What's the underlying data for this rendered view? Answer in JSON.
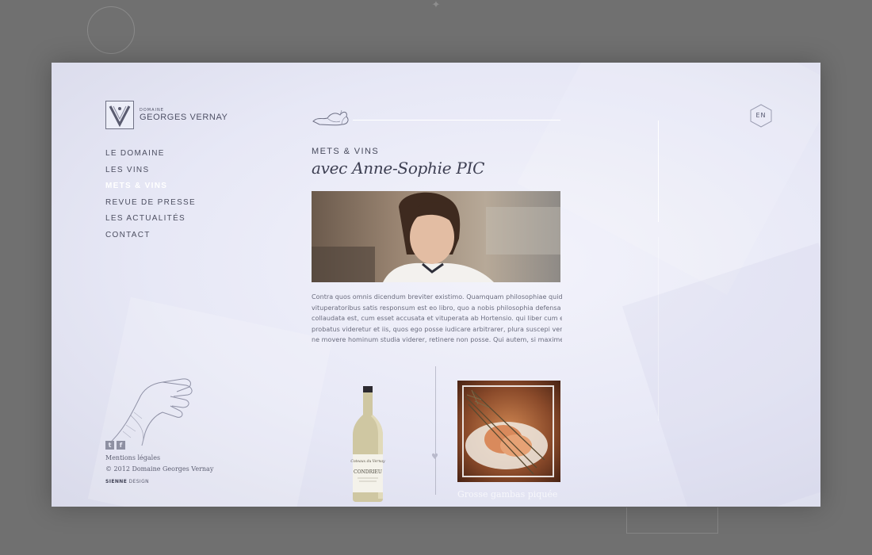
{
  "brand": {
    "domaine": "DOMAINE",
    "name": "GEORGES VERNAY"
  },
  "nav": {
    "items": [
      {
        "label": "LE DOMAINE"
      },
      {
        "label": "LES VINS"
      },
      {
        "label": "METS & VINS",
        "active": true
      },
      {
        "label": "REVUE DE PRESSE"
      },
      {
        "label": "LES ACTUALITÉS"
      },
      {
        "label": "CONTACT"
      }
    ]
  },
  "language": "EN",
  "article": {
    "tag": "METS & VINS",
    "title": "avec Anne-Sophie PIC",
    "body_lines": [
      "Contra quos omnis dicendum breviter existimo. Quamquam philosophiae quidem",
      "vituperatoribus satis responsum est eo libro, quo a nobis philosophia defensa et",
      "collaudata est, cum esset accusata et vituperata ab Hortensio. qui liber cum et tibi",
      "probatus videretur et iis, quos ego posse iudicare arbitrarer, plura suscepi veritus",
      "ne movere hominum studia viderer, retinere non posse. Qui autem, si maxime hoc"
    ]
  },
  "bottle_label": {
    "top": "Coteaux du Vernay",
    "main": "CONDRIEU"
  },
  "dish_caption": "Grosse gambas piquée",
  "footer": {
    "social": [
      "t",
      "f"
    ],
    "legal": "Mentions légales",
    "copyright": "© 2012 Domaine Georges Vernay",
    "credit_brand": "SIENNE",
    "credit_suffix": " DESIGN"
  },
  "colors": {
    "background": "#707070",
    "panel": "#e7e8f6",
    "text": "#4c4e60",
    "active_nav": "#ffffff"
  }
}
